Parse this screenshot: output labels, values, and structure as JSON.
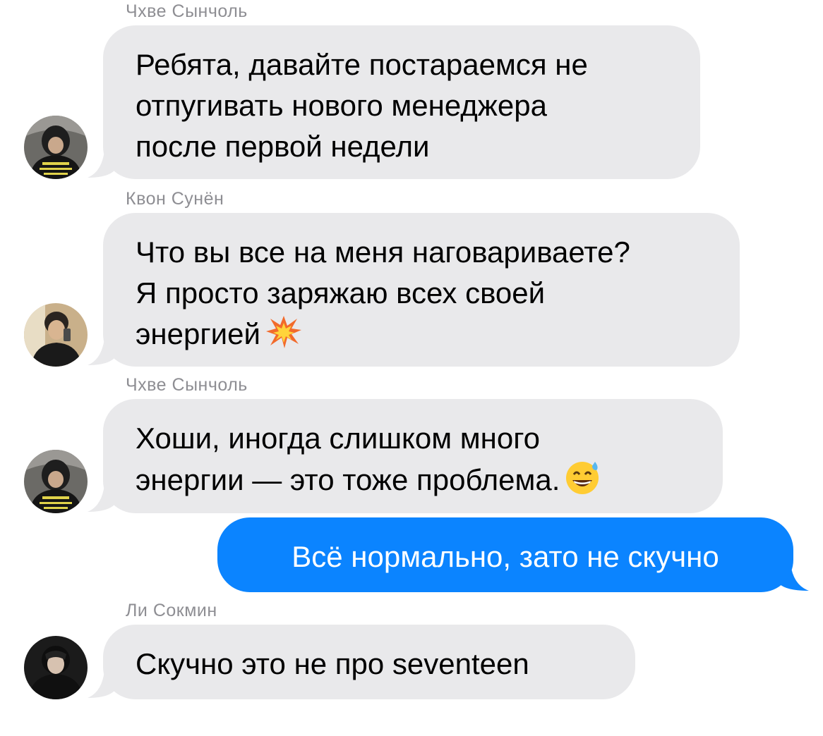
{
  "colors": {
    "incoming_bubble": "#e9e9eb",
    "outgoing_bubble": "#0b84ff",
    "sender_name": "#8e8e93"
  },
  "messages": [
    {
      "sender": "Чхве Сынчоль",
      "lines": [
        "Ребята, давайте постараемся не",
        "отпугивать нового менеджера",
        "после первой недели"
      ],
      "avatar": "seungcheol-avatar"
    },
    {
      "sender": "Квон Сунён",
      "lines": [
        "Что вы все на меня наговариваете?",
        "Я просто заряжаю всех своей",
        "энергией"
      ],
      "emoji": "collision-emoji",
      "avatar": "soonyoung-avatar"
    },
    {
      "sender": "Чхве Сынчоль",
      "lines": [
        "Хоши, иногда слишком много",
        "энергии — это тоже проблема."
      ],
      "emoji": "grinning-sweat-emoji",
      "avatar": "seungcheol-avatar"
    },
    {
      "sender": "",
      "outgoing": true,
      "lines": [
        "Всё нормально, зато не скучно"
      ]
    },
    {
      "sender": "Ли Сокмин",
      "lines": [
        "Скучно это не про seventeen"
      ],
      "avatar": "seokmin-avatar"
    }
  ]
}
